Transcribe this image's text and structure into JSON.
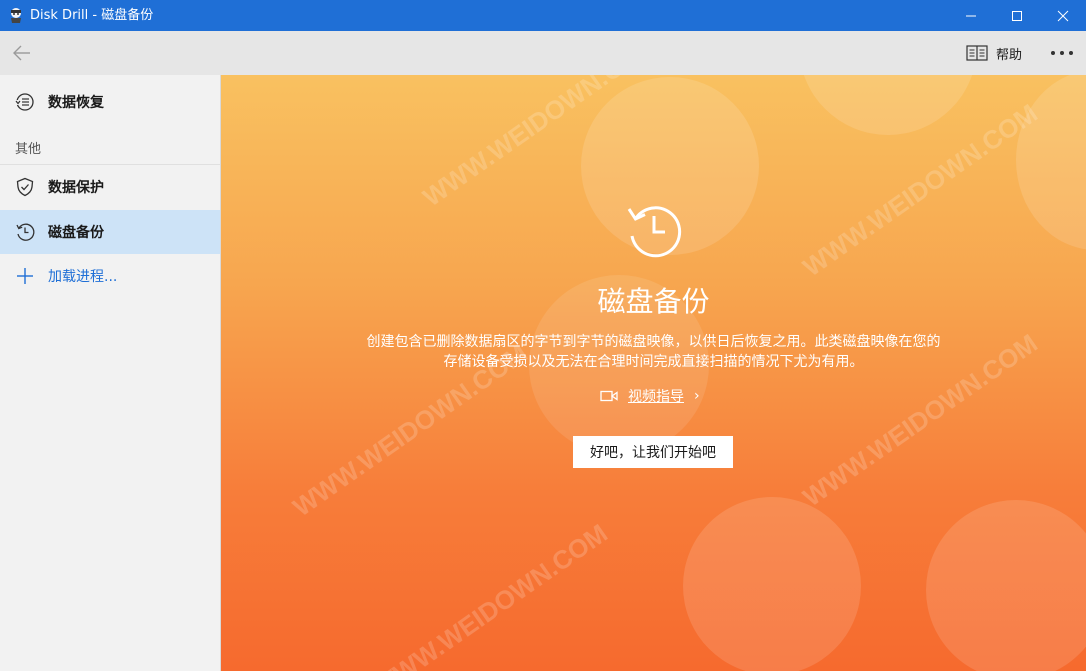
{
  "window": {
    "title": "Disk Drill - 磁盘备份"
  },
  "toolbar": {
    "help_label": "帮助"
  },
  "sidebar": {
    "items": [
      {
        "label": "数据恢复",
        "icon": "recovery-list-icon"
      },
      {
        "label": "数据保护",
        "icon": "shield-check-icon"
      },
      {
        "label": "磁盘备份",
        "icon": "history-clock-icon",
        "selected": true
      },
      {
        "label": "加载进程...",
        "icon": "plus-icon"
      }
    ],
    "section_label": "其他"
  },
  "main": {
    "title": "磁盘备份",
    "description": "创建包含已删除数据扇区的字节到字节的磁盘映像，以供日后恢复之用。此类磁盘映像在您的存储设备受损以及无法在合理时间完成直接扫描的情况下尤为有用。",
    "video_link": "视频指导",
    "video_chevron": "›",
    "start_button": "好吧，让我们开始吧"
  },
  "watermark": "WWW.WEIDOWN.COM",
  "colors": {
    "titlebar": "#1f6fd6",
    "selected_item": "#cde3f7",
    "gradient_top": "#f9c160",
    "gradient_bottom": "#f66a2e"
  }
}
